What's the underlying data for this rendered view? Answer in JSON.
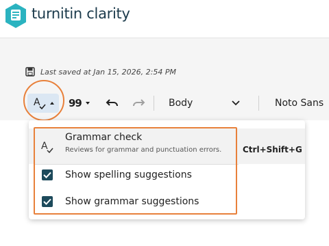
{
  "app": {
    "logo_text": "turnitin clarity"
  },
  "status": {
    "last_saved": "Last saved at Jan 15, 2026, 2:54 PM"
  },
  "toolbar": {
    "spelling_grammar_icon": "spell-check-icon",
    "quote_glyph": "99",
    "style_value": "Body",
    "font_value": "Noto Sans"
  },
  "menu": {
    "grammar": {
      "title": "Grammar check",
      "description": "Reviews for grammar and punctuation errors.",
      "shortcut": "Ctrl+Shift+G"
    },
    "options": [
      {
        "label": "Show spelling suggestions",
        "checked": true
      },
      {
        "label": "Show grammar suggestions",
        "checked": true
      }
    ]
  },
  "colors": {
    "brand_teal": "#2bb3c0",
    "brand_navy": "#1b3a4b",
    "checkbox": "#1d4a5b",
    "annotation": "#e8803a",
    "active_button": "#dbe7f3"
  }
}
